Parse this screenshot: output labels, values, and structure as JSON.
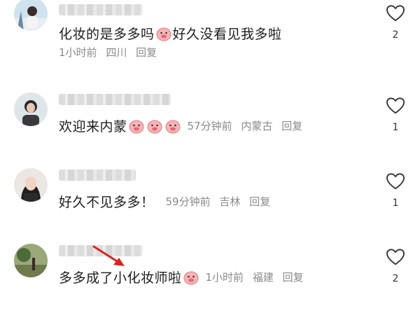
{
  "comments": [
    {
      "content": "化妆的是多多吗",
      "content_after_emoji": "好久没看见我多啦",
      "time": "1小时前",
      "location": "四川",
      "reply_label": "回复",
      "likes": "2"
    },
    {
      "content": "欢迎来内蒙",
      "time": "57分钟前",
      "location": "内蒙古",
      "reply_label": "回复",
      "likes": "1"
    },
    {
      "content": "好久不见多多！",
      "time": "59分钟前",
      "location": "吉林",
      "reply_label": "回复",
      "likes": "1"
    },
    {
      "content": "多多成了小化妆师啦",
      "time": "1小时前",
      "location": "福建",
      "reply_label": "回复",
      "likes": "2"
    }
  ],
  "icons": {
    "like": "heart-outline-icon",
    "emoji": "pig-face-emoji-icon",
    "annotation": "red-arrow-icon"
  },
  "colors": {
    "meta_text": "#8a8a8a",
    "arrow": "#e02020",
    "emoji_pink": "#f7a4a8"
  }
}
